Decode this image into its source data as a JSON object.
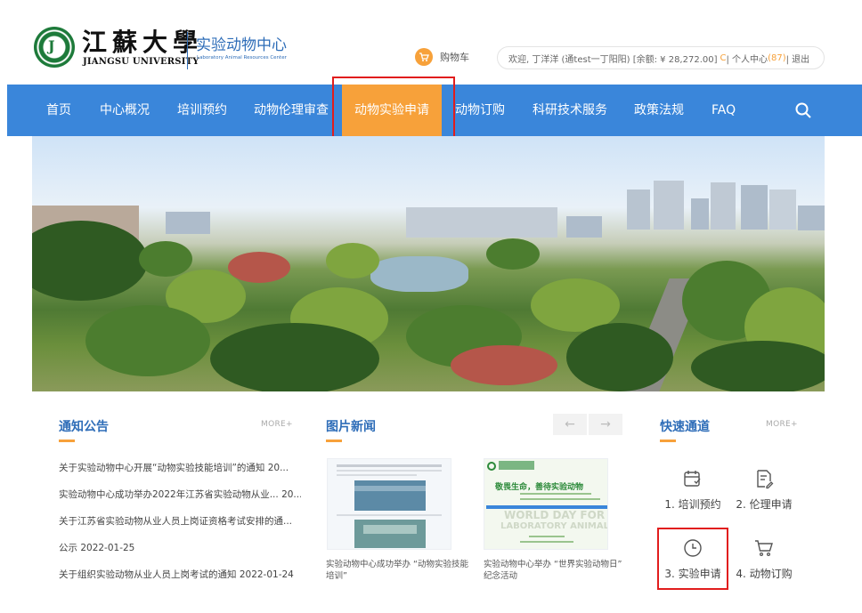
{
  "header": {
    "logo_cn": "江蘇大學",
    "logo_en": "JIANGSU UNIVERSITY",
    "seal_letter": "J",
    "center_cn": "实验动物中心",
    "center_en": "Laboratory Animal Resources Center",
    "cart_label": "购物车",
    "user": {
      "welcome": "欢迎, 丁洋洋 (通test一丁阳阳) [余额: ¥ 28,272.00]",
      "refresh_symbol": "C",
      "separator1": " | 个人中心",
      "count": "(87)",
      "separator2": " | 退出"
    }
  },
  "nav": {
    "items": [
      "首页",
      "中心概况",
      "培训预约",
      "动物伦理审查",
      "动物实验申请",
      "动物订购",
      "科研技术服务",
      "政策法规",
      "FAQ"
    ],
    "active_index": 4
  },
  "notices": {
    "title": "通知公告",
    "more": "MORE+",
    "items": [
      "关于实验动物中心开展“动物实验技能培训”的通知 20...",
      "实验动物中心成功举办2022年江苏省实验动物从业... 20...",
      "关于江苏省实验动物从业人员上岗证资格考试安排的通...",
      "公示 2022-01-25",
      "关于组织实验动物从业人员上岗考试的通知 2022-01-24"
    ]
  },
  "photo_news": {
    "title": "图片新闻",
    "prev": "←",
    "next": "→",
    "items": [
      {
        "caption": "实验动物中心成功举办 “动物实验技能培训”"
      },
      {
        "caption": "实验动物中心举办 “世界实验动物日” 纪念活动",
        "poster_lines": [
          "敬畏生命，善待实验动物",
          "WORLD DAY FOR",
          "LABORATORY ANIMALS"
        ]
      }
    ]
  },
  "quick": {
    "title": "快速通道",
    "more": "MORE+",
    "items": [
      {
        "label": "1. 培训预约",
        "icon": "calendar-icon"
      },
      {
        "label": "2. 伦理申请",
        "icon": "document-edit-icon"
      },
      {
        "label": "3. 实验申请",
        "icon": "clock-icon"
      },
      {
        "label": "4. 动物订购",
        "icon": "cart-icon"
      }
    ]
  },
  "colors": {
    "nav_blue": "#3a86da",
    "accent_orange": "#f7a13a",
    "title_blue": "#2e6db8",
    "highlight_red": "#e11d1d"
  }
}
